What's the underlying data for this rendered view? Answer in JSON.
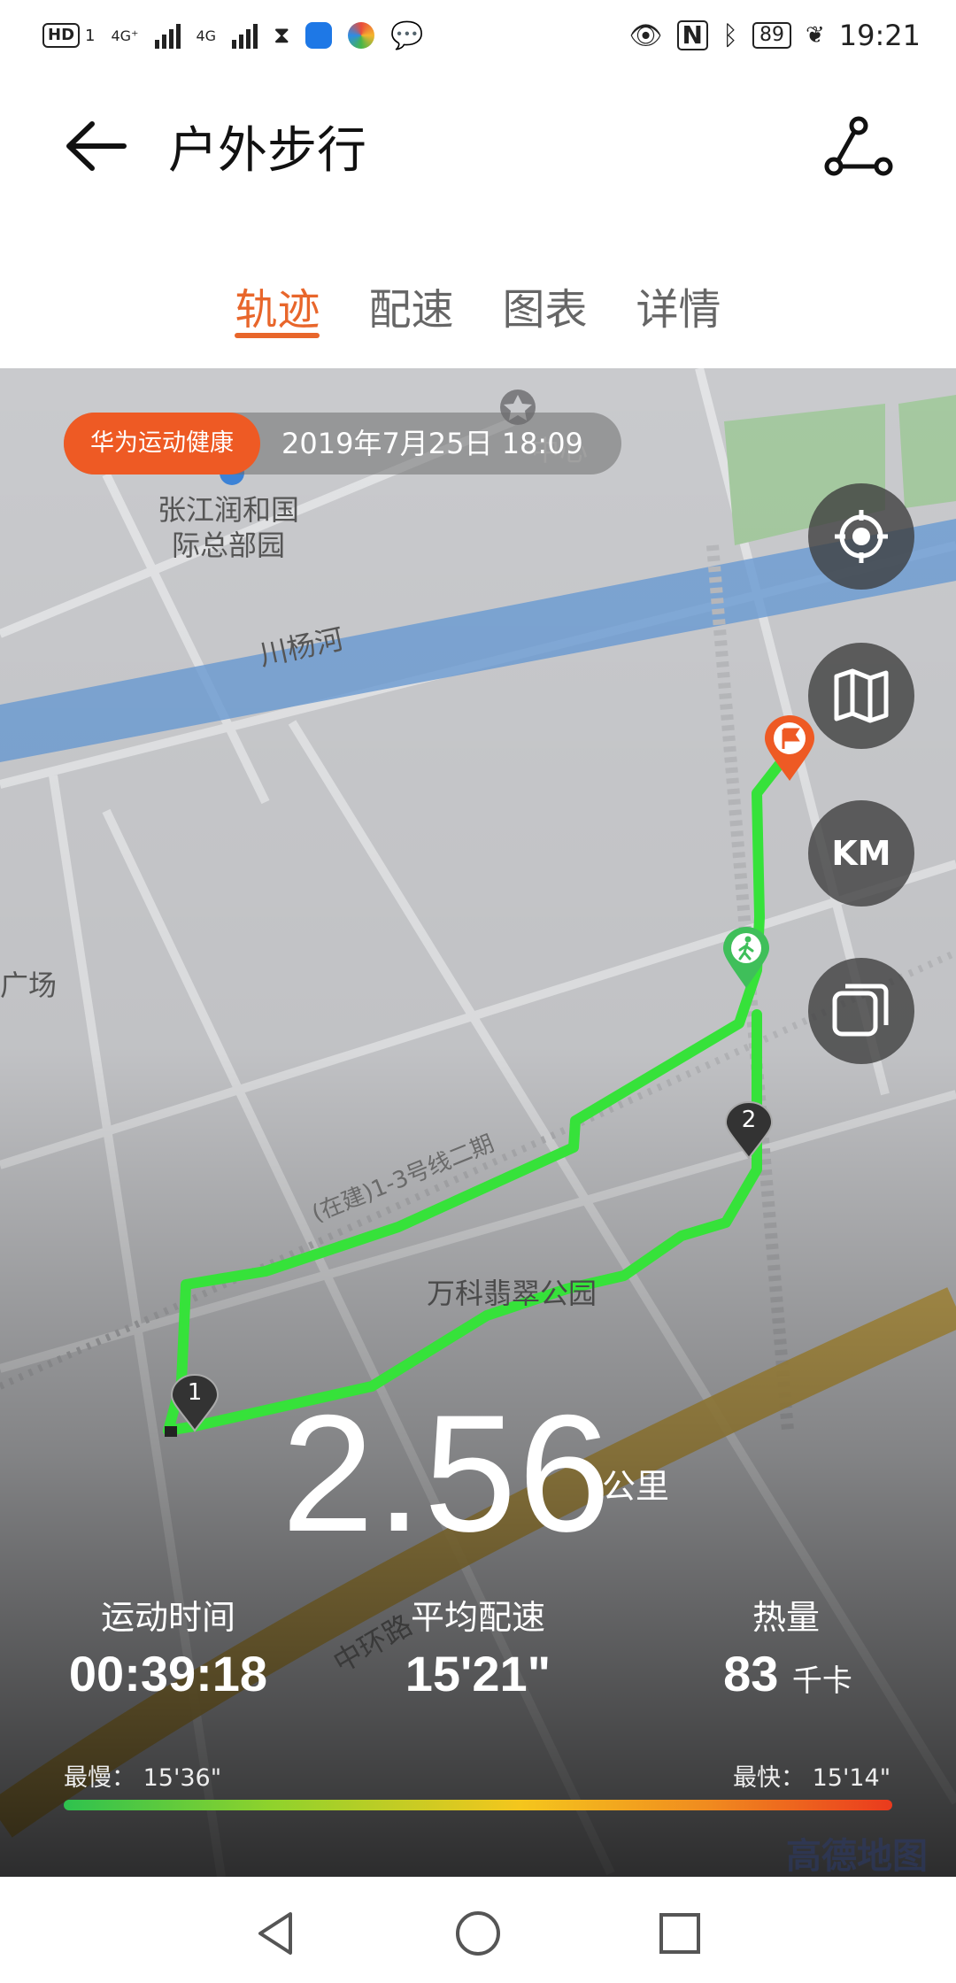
{
  "status_bar": {
    "left_text": "HD",
    "sim_label": "1",
    "signal1": "4G⁺",
    "signal2": "4G",
    "battery": "89",
    "time": "19:21"
  },
  "header": {
    "title": "户外步行"
  },
  "tabs": [
    {
      "label": "轨迹",
      "active": true
    },
    {
      "label": "配速",
      "active": false
    },
    {
      "label": "图表",
      "active": false
    },
    {
      "label": "详情",
      "active": false
    }
  ],
  "map": {
    "badge": "华为运动健康",
    "date": "2019年7月25日 18:09",
    "labels": {
      "building": "张江润和国际总部园",
      "building_line1": "张江润和国",
      "building_line2": "际总部园",
      "river": "川杨河",
      "plaza": "广场",
      "park": "万科翡翠公园",
      "railway": "(在建)1-3号线二期",
      "road": "中环路",
      "center_partial": "中心"
    },
    "markers": {
      "m1": "1",
      "m2": "2"
    },
    "controls": {
      "km": "KM"
    },
    "watermark": "高德地图",
    "colors": {
      "track": "#36e23a",
      "accent": "#ee5a24",
      "walker": "#3fbf5a"
    }
  },
  "summary": {
    "distance": "2.56",
    "distance_unit": "公里",
    "stats": [
      {
        "label": "运动时间",
        "value": "00:39:18",
        "unit": ""
      },
      {
        "label": "平均配速",
        "value": "15'21\"",
        "unit": ""
      },
      {
        "label": "热量",
        "value": "83",
        "unit": "千卡"
      }
    ],
    "slowest": "最慢：  15'36\"",
    "fastest": "最快：  15'14\""
  }
}
